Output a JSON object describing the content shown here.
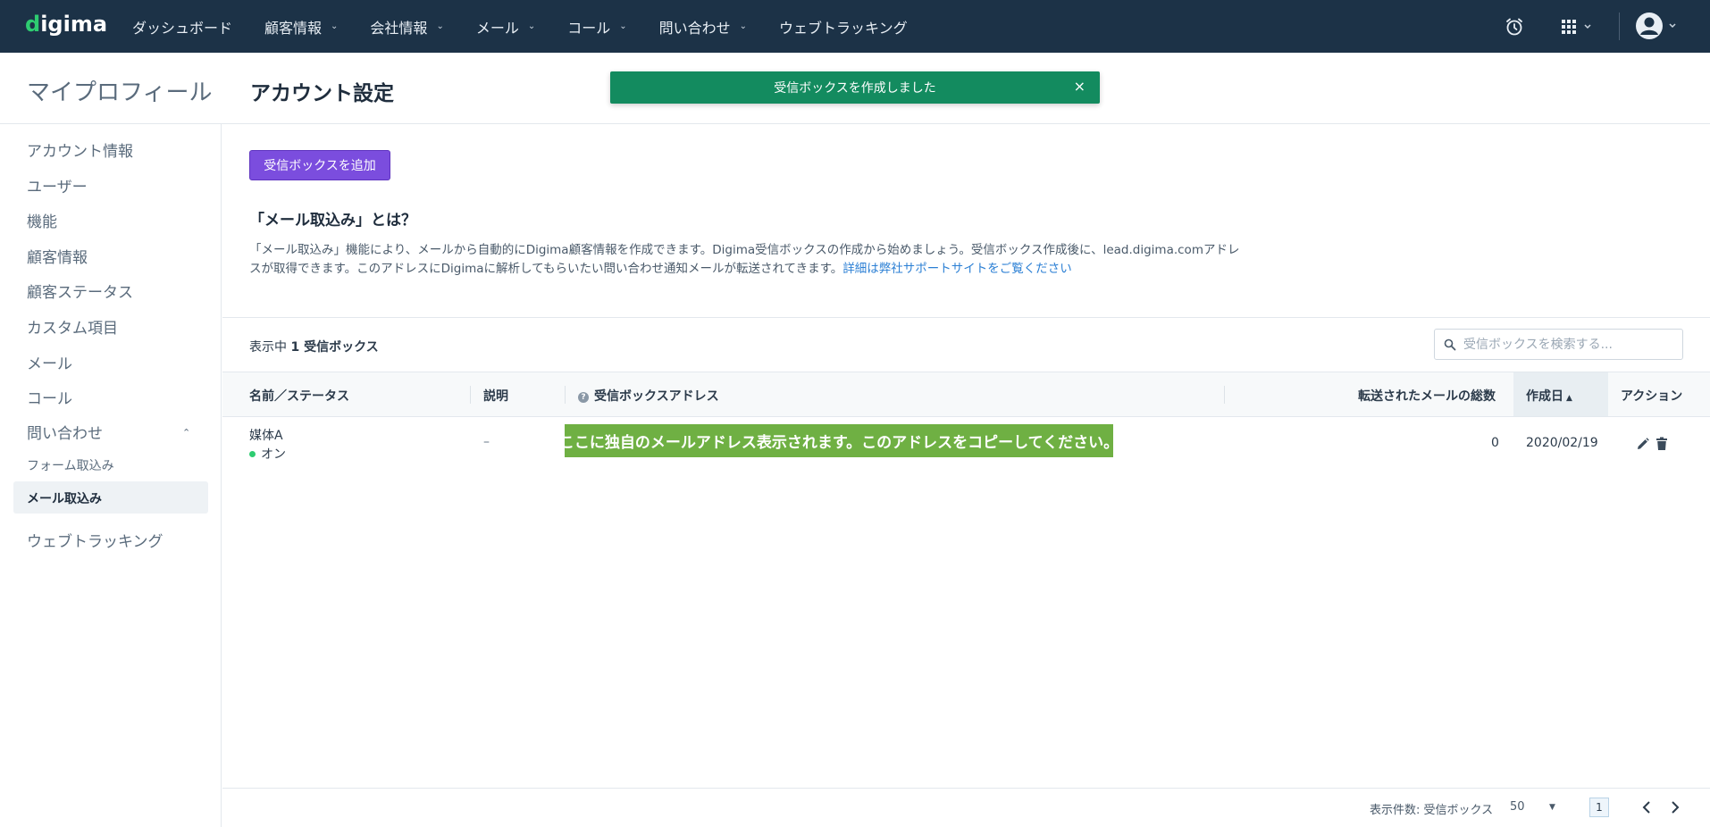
{
  "nav": {
    "logo_d": "d",
    "logo_rest": "igima",
    "items": [
      {
        "label": "ダッシュボード",
        "dropdown": false
      },
      {
        "label": "顧客情報",
        "dropdown": true
      },
      {
        "label": "会社情報",
        "dropdown": true
      },
      {
        "label": "メール",
        "dropdown": true
      },
      {
        "label": "コール",
        "dropdown": true
      },
      {
        "label": "問い合わせ",
        "dropdown": true
      },
      {
        "label": "ウェブトラッキング",
        "dropdown": false
      }
    ]
  },
  "header": {
    "section": "マイプロフィール",
    "title": "アカウント設定"
  },
  "toast": {
    "message": "受信ボックスを作成しました",
    "close": "×"
  },
  "sidebar": {
    "items": [
      "アカウント情報",
      "ユーザー",
      "機能",
      "顧客情報",
      "顧客ステータス",
      "カスタム項目",
      "メール",
      "コール",
      "問い合わせ"
    ],
    "sub_items": [
      "フォーム取込み",
      "メール取込み"
    ],
    "after": "ウェブトラッキング"
  },
  "main": {
    "add_button": "受信ボックスを追加",
    "section_title": "「メール取込み」とは？",
    "desc_text": "「メール取込み」機能により、メールから自動的にDigima顧客情報を作成できます。Digima受信ボックスの作成から始めましょう。受信ボックス作成後に、lead.digima.comアドレスが取得できます。このアドレスにDigimaに解析してもらいたい問い合わせ通知メールが転送されてきます。",
    "desc_link": "詳細は弊社サポートサイトをご覧ください",
    "count_prefix": "表示中",
    "count_value": "1 受信ボックス",
    "search_placeholder": "受信ボックスを検索する..."
  },
  "table": {
    "headers": {
      "name": "名前／ステータス",
      "desc": "説明",
      "address": "受信ボックスアドレス",
      "total": "転送されたメールの総数",
      "created": "作成日",
      "actions": "アクション"
    },
    "rows": [
      {
        "name": "媒体A",
        "status": "オン",
        "description": "–",
        "address_note": "ここに独自のメールアドレス表示されます。このアドレスをコピーしてください。",
        "total": "0",
        "created": "2020/02/19"
      }
    ]
  },
  "footer": {
    "per_page_label": "表示件数: 受信ボックス",
    "per_page_value": "50",
    "page": "1"
  },
  "colors": {
    "nav_bg": "#1c3247",
    "toast_bg": "#138b5f",
    "primary_button": "#7b4dde",
    "address_banner": "#6fb043",
    "status_on": "#2ecc71",
    "link": "#2b7fd4"
  }
}
